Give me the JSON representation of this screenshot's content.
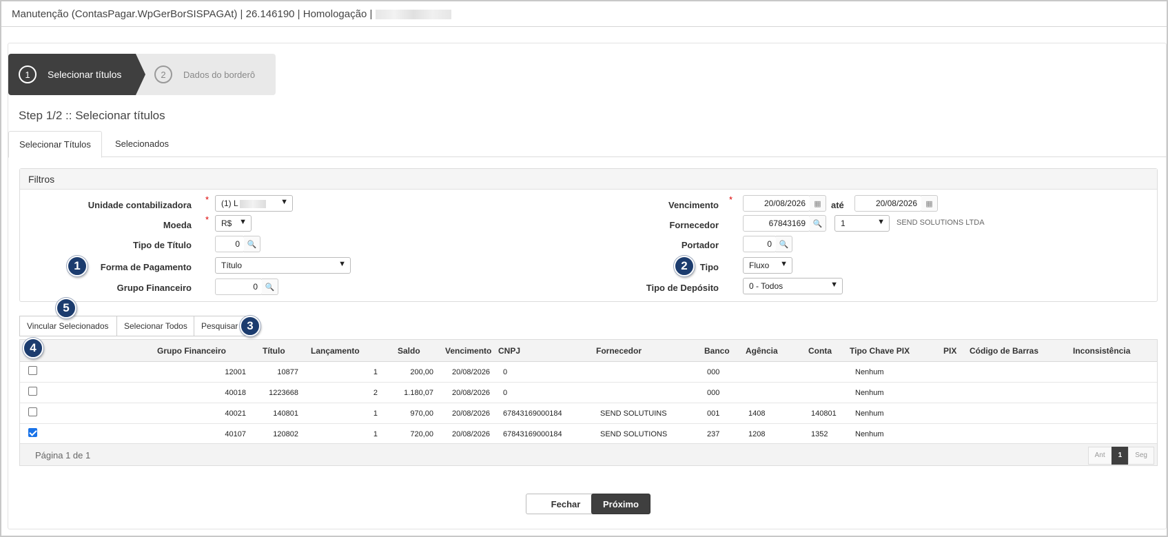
{
  "window": {
    "title": "Manutenção (ContasPagar.WpGerBorSISPAGAt) | 26.146190 | Homologação |"
  },
  "wizard": {
    "steps": [
      {
        "num": "1",
        "label": "Selecionar títulos"
      },
      {
        "num": "2",
        "label": "Dados do borderô"
      }
    ],
    "heading": "Step 1/2 :: Selecionar títulos"
  },
  "tabs": [
    {
      "label": "Selecionar Títulos"
    },
    {
      "label": "Selecionados"
    }
  ],
  "filters": {
    "title": "Filtros",
    "unidade": {
      "label": "Unidade contabilizadora",
      "value": "(1) L"
    },
    "moeda": {
      "label": "Moeda",
      "value": "R$"
    },
    "tipo_titulo": {
      "label": "Tipo de Título",
      "value": "0"
    },
    "forma_pagamento": {
      "label": "Forma de Pagamento",
      "value": "Título"
    },
    "grupo_financeiro": {
      "label": "Grupo Financeiro",
      "value": "0"
    },
    "vencimento": {
      "label": "Vencimento",
      "from": "20/08/2026",
      "to_label": "até",
      "to": "20/08/2026"
    },
    "fornecedor": {
      "label": "Fornecedor",
      "code": "67843169",
      "seq": "1",
      "name": "SEND SOLUTIONS LTDA"
    },
    "portador": {
      "label": "Portador",
      "value": "0"
    },
    "tipo": {
      "label": "Tipo",
      "value": "Fluxo"
    },
    "tipo_deposito": {
      "label": "Tipo de Depósito",
      "value": "0 - Todos"
    },
    "required_mark": "*"
  },
  "badges": {
    "b1": "1",
    "b2": "2",
    "b3": "3",
    "b4": "4",
    "b5": "5"
  },
  "toolbar": {
    "vincular": "Vincular Selecionados",
    "selecionar_todos": "Selecionar Todos",
    "pesquisar": "Pesquisar"
  },
  "grid": {
    "columns": [
      "Grupo Financeiro",
      "Título",
      "Lançamento",
      "Saldo",
      "Vencimento",
      "CNPJ",
      "Fornecedor",
      "Banco",
      "Agência",
      "Conta",
      "Tipo Chave PIX",
      "PIX",
      "Código de Barras",
      "Inconsistência"
    ],
    "rows": [
      {
        "checked": false,
        "grupo": "12001",
        "titulo": "10877",
        "lanc": "1",
        "saldo": "200,00",
        "venc": "20/08/2026",
        "cnpj": "0",
        "fornecedor": "",
        "banco": "000",
        "agencia": "",
        "conta": "",
        "tipo_pix": "Nenhum"
      },
      {
        "checked": false,
        "grupo": "40018",
        "titulo": "1223668",
        "lanc": "2",
        "saldo": "1.180,07",
        "venc": "20/08/2026",
        "cnpj": "0",
        "fornecedor": "",
        "banco": "000",
        "agencia": "",
        "conta": "",
        "tipo_pix": "Nenhum"
      },
      {
        "checked": false,
        "grupo": "40021",
        "titulo": "140801",
        "lanc": "1",
        "saldo": "970,00",
        "venc": "20/08/2026",
        "cnpj": "67843169000184",
        "fornecedor": "SEND SOLUTUINS",
        "banco": "001",
        "agencia": "1408",
        "conta": "140801",
        "tipo_pix": "Nenhum"
      },
      {
        "checked": true,
        "grupo": "40107",
        "titulo": "120802",
        "lanc": "1",
        "saldo": "720,00",
        "venc": "20/08/2026",
        "cnpj": "67843169000184",
        "fornecedor": "SEND SOLUTIONS",
        "banco": "237",
        "agencia": "1208",
        "conta": "1352",
        "tipo_pix": "Nenhum"
      }
    ],
    "page_info": "Página 1 de 1",
    "pager": {
      "prev": "Ant",
      "current": "1",
      "next": "Seg"
    }
  },
  "footer": {
    "close": "Fechar",
    "next": "Próximo"
  },
  "colors": {
    "dark": "#3f3f3f",
    "badge": "#1c3c6e",
    "required": "#dd0000",
    "check": "#1a73e8"
  }
}
